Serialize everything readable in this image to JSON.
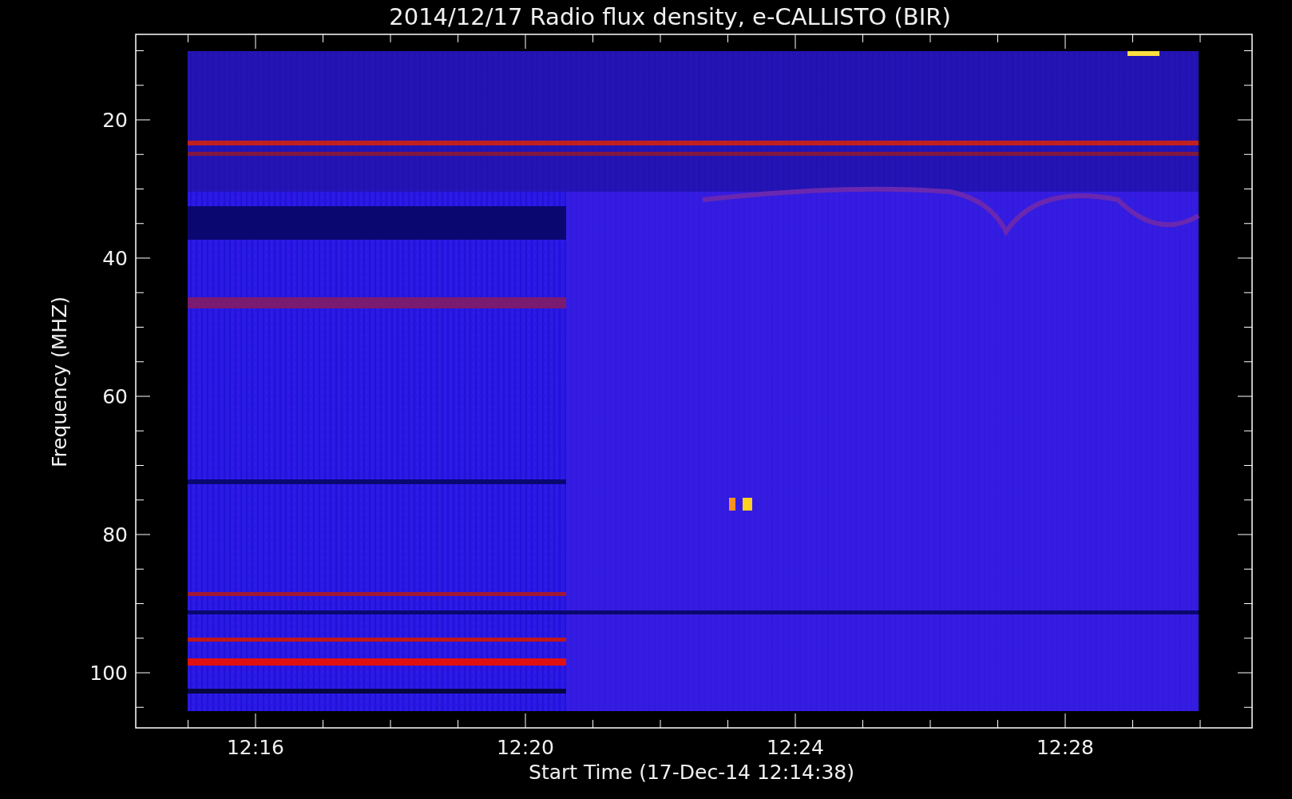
{
  "title": "2014/12/17  Radio flux density, e-CALLISTO (BIR)",
  "y_axis": {
    "label": "Frequency (MHZ)",
    "tick_labels": [
      "20",
      "40",
      "60",
      "80",
      "100"
    ]
  },
  "x_axis": {
    "label": "Start Time (17-Dec-14 12:14:38)",
    "tick_labels": [
      "12:16",
      "12:20",
      "12:24",
      "12:28"
    ]
  }
}
